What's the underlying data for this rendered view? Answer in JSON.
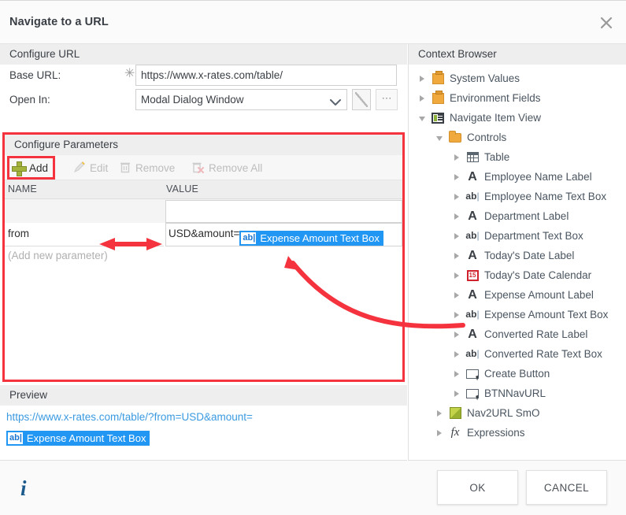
{
  "window": {
    "title": "Navigate to a URL",
    "close_icon": "close-icon"
  },
  "configure_url": {
    "section_title": "Configure URL",
    "base_url_label": "Base URL:",
    "base_url_value": "https://www.x-rates.com/table/",
    "base_url_required_marker": "✳",
    "open_in_label": "Open In:",
    "open_in_value": "Modal Dialog Window",
    "open_in_options": [
      "Modal Dialog Window"
    ],
    "ellipsis_label": "⋯"
  },
  "configure_parameters": {
    "section_title": "Configure Parameters",
    "toolbar": {
      "add_label": "Add",
      "edit_label": "Edit",
      "remove_label": "Remove",
      "remove_all_label": "Remove All"
    },
    "columns": [
      "NAME",
      "VALUE"
    ],
    "rows": [
      {
        "name": "",
        "value_text": "",
        "token": ""
      },
      {
        "name": "from",
        "value_text": "USD&amount=",
        "token": "Expense Amount Text Box",
        "token_icon": "ab|"
      }
    ],
    "add_new_hint": "(Add new parameter)"
  },
  "preview": {
    "section_title": "Preview",
    "url_text": "https://www.x-rates.com/table/?from=USD&amount=",
    "token": "Expense Amount Text Box",
    "token_icon": "ab|"
  },
  "context_browser": {
    "section_title": "Context Browser",
    "nodes": [
      {
        "label": "System Values",
        "icon": "briefcase-icon",
        "indent": 0,
        "expanded": false
      },
      {
        "label": "Environment Fields",
        "icon": "briefcase-icon",
        "indent": 0,
        "expanded": false
      },
      {
        "label": "Navigate Item View",
        "icon": "view-icon",
        "indent": 0,
        "expanded": true
      },
      {
        "label": "Controls",
        "icon": "folder-icon",
        "indent": 1,
        "expanded": true
      },
      {
        "label": "Table",
        "icon": "grid-icon",
        "indent": 2,
        "expanded": false
      },
      {
        "label": "Employee Name Label",
        "icon": "label-icon",
        "indent": 2,
        "expanded": false
      },
      {
        "label": "Employee Name Text Box",
        "icon": "textbox-icon",
        "indent": 2,
        "expanded": false
      },
      {
        "label": "Department Label",
        "icon": "label-icon",
        "indent": 2,
        "expanded": false
      },
      {
        "label": "Department Text Box",
        "icon": "textbox-icon",
        "indent": 2,
        "expanded": false
      },
      {
        "label": "Today's Date Label",
        "icon": "label-icon",
        "indent": 2,
        "expanded": false
      },
      {
        "label": "Today's Date Calendar",
        "icon": "calendar-icon",
        "indent": 2,
        "expanded": false
      },
      {
        "label": "Expense Amount Label",
        "icon": "label-icon",
        "indent": 2,
        "expanded": false
      },
      {
        "label": "Expense Amount Text Box",
        "icon": "textbox-icon",
        "indent": 2,
        "expanded": false
      },
      {
        "label": "Converted Rate Label",
        "icon": "label-icon",
        "indent": 2,
        "expanded": false
      },
      {
        "label": "Converted Rate Text Box",
        "icon": "textbox-icon",
        "indent": 2,
        "expanded": false
      },
      {
        "label": "Create Button",
        "icon": "button-icon",
        "indent": 2,
        "expanded": false
      },
      {
        "label": "BTNNavURL",
        "icon": "button-icon",
        "indent": 2,
        "expanded": false
      },
      {
        "label": "Nav2URL SmO",
        "icon": "cube-icon",
        "indent": 1,
        "expanded": false
      },
      {
        "label": "Expressions",
        "icon": "fx-icon",
        "indent": 1,
        "expanded": false
      }
    ],
    "calendar_icon_text": "15",
    "fx_icon_text": "fx",
    "textbox_icon_text": "ab"
  },
  "footer": {
    "info_icon": "i",
    "ok_label": "OK",
    "cancel_label": "CANCEL"
  },
  "colors": {
    "annotation_red": "#f5333f",
    "token_blue": "#2196f3",
    "link_blue": "#3a9ae0",
    "add_green": "#a3b33b",
    "folder_orange": "#efa93c"
  }
}
